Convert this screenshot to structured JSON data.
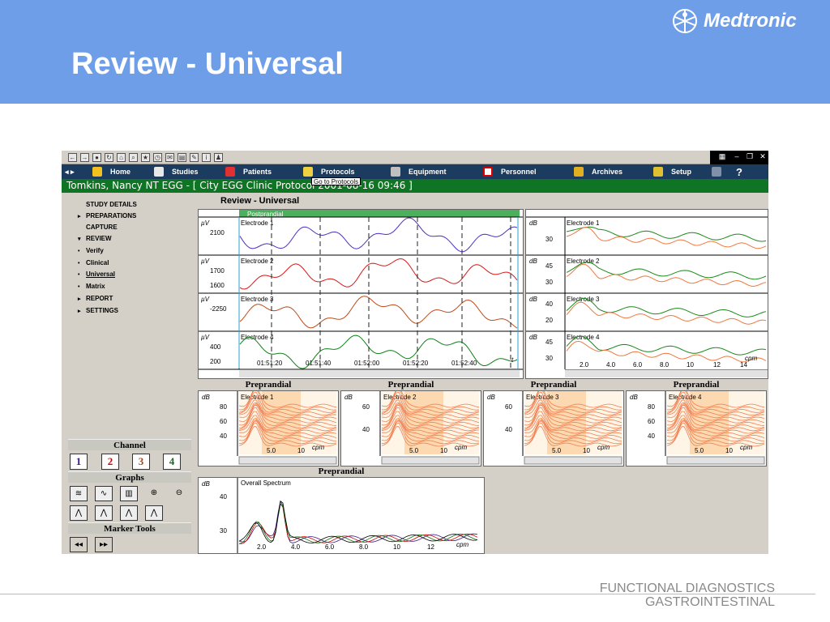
{
  "slide": {
    "title": "Review - Universal",
    "logo": "Medtronic",
    "footer_line1": "FUNCTIONAL DIAGNOSTICS",
    "footer_line2": "GASTROINTESTINAL"
  },
  "app": {
    "nav": [
      "Home",
      "Studies",
      "Patients",
      "Protocols",
      "Equipment",
      "Personnel",
      "Archives",
      "Setup"
    ],
    "help": "?",
    "tooltip": "Go to Protocols",
    "header": "Tomkins, Nancy  NT  EGG  - [ City EGG Clinic Protocol   2001-08-16  09:46 ]",
    "page_title": "Review - Universal",
    "sidebar": [
      {
        "label": "STUDY DETAILS",
        "marker": ""
      },
      {
        "label": "PREPARATIONS",
        "marker": "▸"
      },
      {
        "label": "CAPTURE",
        "marker": ""
      },
      {
        "label": "REVIEW",
        "marker": "▾"
      },
      {
        "label": "Verify",
        "marker": "•"
      },
      {
        "label": "Clinical",
        "marker": "•"
      },
      {
        "label": "Universal",
        "marker": "•"
      },
      {
        "label": "Matrix",
        "marker": "•"
      },
      {
        "label": "REPORT",
        "marker": "▸"
      },
      {
        "label": "SETTINGS",
        "marker": "▸"
      }
    ],
    "channel_title": "Channel",
    "channels": [
      "1",
      "2",
      "3",
      "4"
    ],
    "channel_colors": [
      "#3a1a8a",
      "#d00000",
      "#b04010",
      "#107010"
    ],
    "graphs_title": "Graphs",
    "marker_title": "Marker Tools",
    "marker_buttons": [
      "◂◂",
      "▸▸"
    ]
  },
  "chart_data": [
    {
      "type": "line",
      "title": "Postprandial",
      "series": [
        {
          "name": "Electrode 1",
          "unit": "µV",
          "yticks": [
            "2100"
          ]
        },
        {
          "name": "Electrode 2",
          "unit": "µV",
          "yticks": [
            "1700",
            "1600"
          ]
        },
        {
          "name": "Electrode 3",
          "unit": "µV",
          "yticks": [
            "-2250"
          ]
        },
        {
          "name": "Electrode 4",
          "unit": "µV",
          "yticks": [
            "400",
            "200"
          ]
        }
      ],
      "x_ticks": [
        "01:51:20",
        "01:51:40",
        "01:52:00",
        "01:52:20",
        "01:52:40"
      ],
      "x_end": "t"
    },
    {
      "type": "line",
      "series": [
        {
          "name": "Electrode 1",
          "unit": "dB",
          "yticks": [
            "30"
          ]
        },
        {
          "name": "Electrode 2",
          "unit": "dB",
          "yticks": [
            "45",
            "30"
          ]
        },
        {
          "name": "Electrode 3",
          "unit": "dB",
          "yticks": [
            "40",
            "20"
          ]
        },
        {
          "name": "Electrode 4",
          "unit": "dB",
          "yticks": [
            "45",
            "30"
          ]
        }
      ],
      "x_ticks": [
        "2.0",
        "4.0",
        "6.0",
        "8.0",
        "10",
        "12",
        "14"
      ],
      "x_unit": "cpm"
    },
    {
      "type": "area",
      "title": "Preprandial",
      "panels": [
        {
          "name": "Electrode 1",
          "unit": "dB",
          "yticks": [
            "80",
            "60",
            "40"
          ],
          "x_ticks": [
            "5.0",
            "10"
          ],
          "x_unit": "cpm"
        },
        {
          "name": "Electrode 2",
          "unit": "dB",
          "yticks": [
            "60",
            "40"
          ],
          "x_ticks": [
            "5.0",
            "10"
          ],
          "x_unit": "cpm"
        },
        {
          "name": "Electrode 3",
          "unit": "dB",
          "yticks": [
            "60",
            "40"
          ],
          "x_ticks": [
            "5.0",
            "10"
          ],
          "x_unit": "cpm"
        },
        {
          "name": "Electrode 4",
          "unit": "dB",
          "yticks": [
            "80",
            "60",
            "40"
          ],
          "x_ticks": [
            "5.0",
            "10"
          ],
          "x_unit": "cpm"
        }
      ]
    },
    {
      "type": "line",
      "title": "Preprandial",
      "name": "Overall Spectrum",
      "unit": "dB",
      "yticks": [
        "40",
        "30"
      ],
      "x_ticks": [
        "2.0",
        "4.0",
        "6.0",
        "8.0",
        "10",
        "12"
      ],
      "x_unit": "cpm"
    }
  ]
}
